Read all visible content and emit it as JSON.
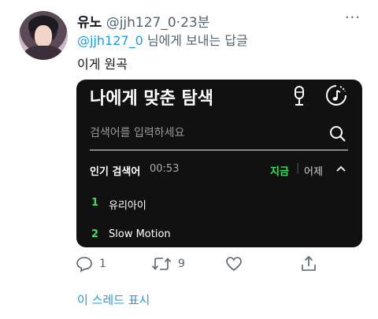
{
  "tweet": {
    "author_name": "유노",
    "handle": "@jjh127_0",
    "separator": "·",
    "time": "23분",
    "more_label": "···",
    "reply_mention": "@jjh127_0",
    "reply_suffix": " 님에게 보내는 답글",
    "text": "이게 원곡"
  },
  "card": {
    "title": "나에게 맞춘 탐색",
    "search_placeholder": "검색어를 입력하세요",
    "trending_label": "인기 검색어",
    "trending_time": "00:53",
    "tab_now": "지금",
    "tab_separator": "|",
    "tab_yesterday": "어제",
    "items": [
      {
        "rank": "1",
        "title": "유리아이"
      },
      {
        "rank": "2",
        "title": "Slow Motion"
      }
    ],
    "accent_color": "#3adf5a"
  },
  "actions": {
    "replies": "1",
    "retweets": "9"
  },
  "thread_link": "이 스레드 표시"
}
